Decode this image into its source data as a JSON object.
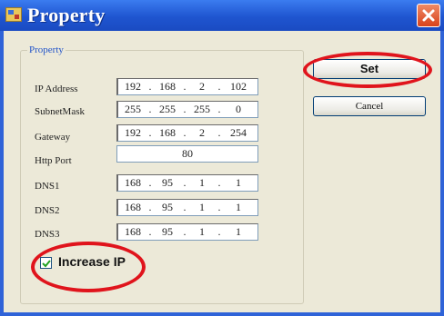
{
  "window": {
    "title": "Property"
  },
  "group": {
    "label": "Property"
  },
  "fields": [
    {
      "label": "IP Address",
      "octets": [
        "192",
        "168",
        "2",
        "102"
      ]
    },
    {
      "label": "SubnetMask",
      "octets": [
        "255",
        "255",
        "255",
        "0"
      ]
    },
    {
      "label": "Gateway",
      "octets": [
        "192",
        "168",
        "2",
        "254"
      ]
    }
  ],
  "http_port": {
    "label": "Http Port",
    "value": "80"
  },
  "dns": [
    {
      "label": "DNS1",
      "octets": [
        "168",
        "95",
        "1",
        "1"
      ]
    },
    {
      "label": "DNS2",
      "octets": [
        "168",
        "95",
        "1",
        "1"
      ]
    },
    {
      "label": "DNS3",
      "octets": [
        "168",
        "95",
        "1",
        "1"
      ]
    }
  ],
  "buttons": {
    "set": "Set",
    "cancel": "Cancel"
  },
  "checkbox": {
    "label": "Increase IP",
    "checked": true
  },
  "colors": {
    "titlebar": "#2f63d8",
    "highlight": "#e0141c",
    "dialog_bg": "#ece9d8"
  }
}
